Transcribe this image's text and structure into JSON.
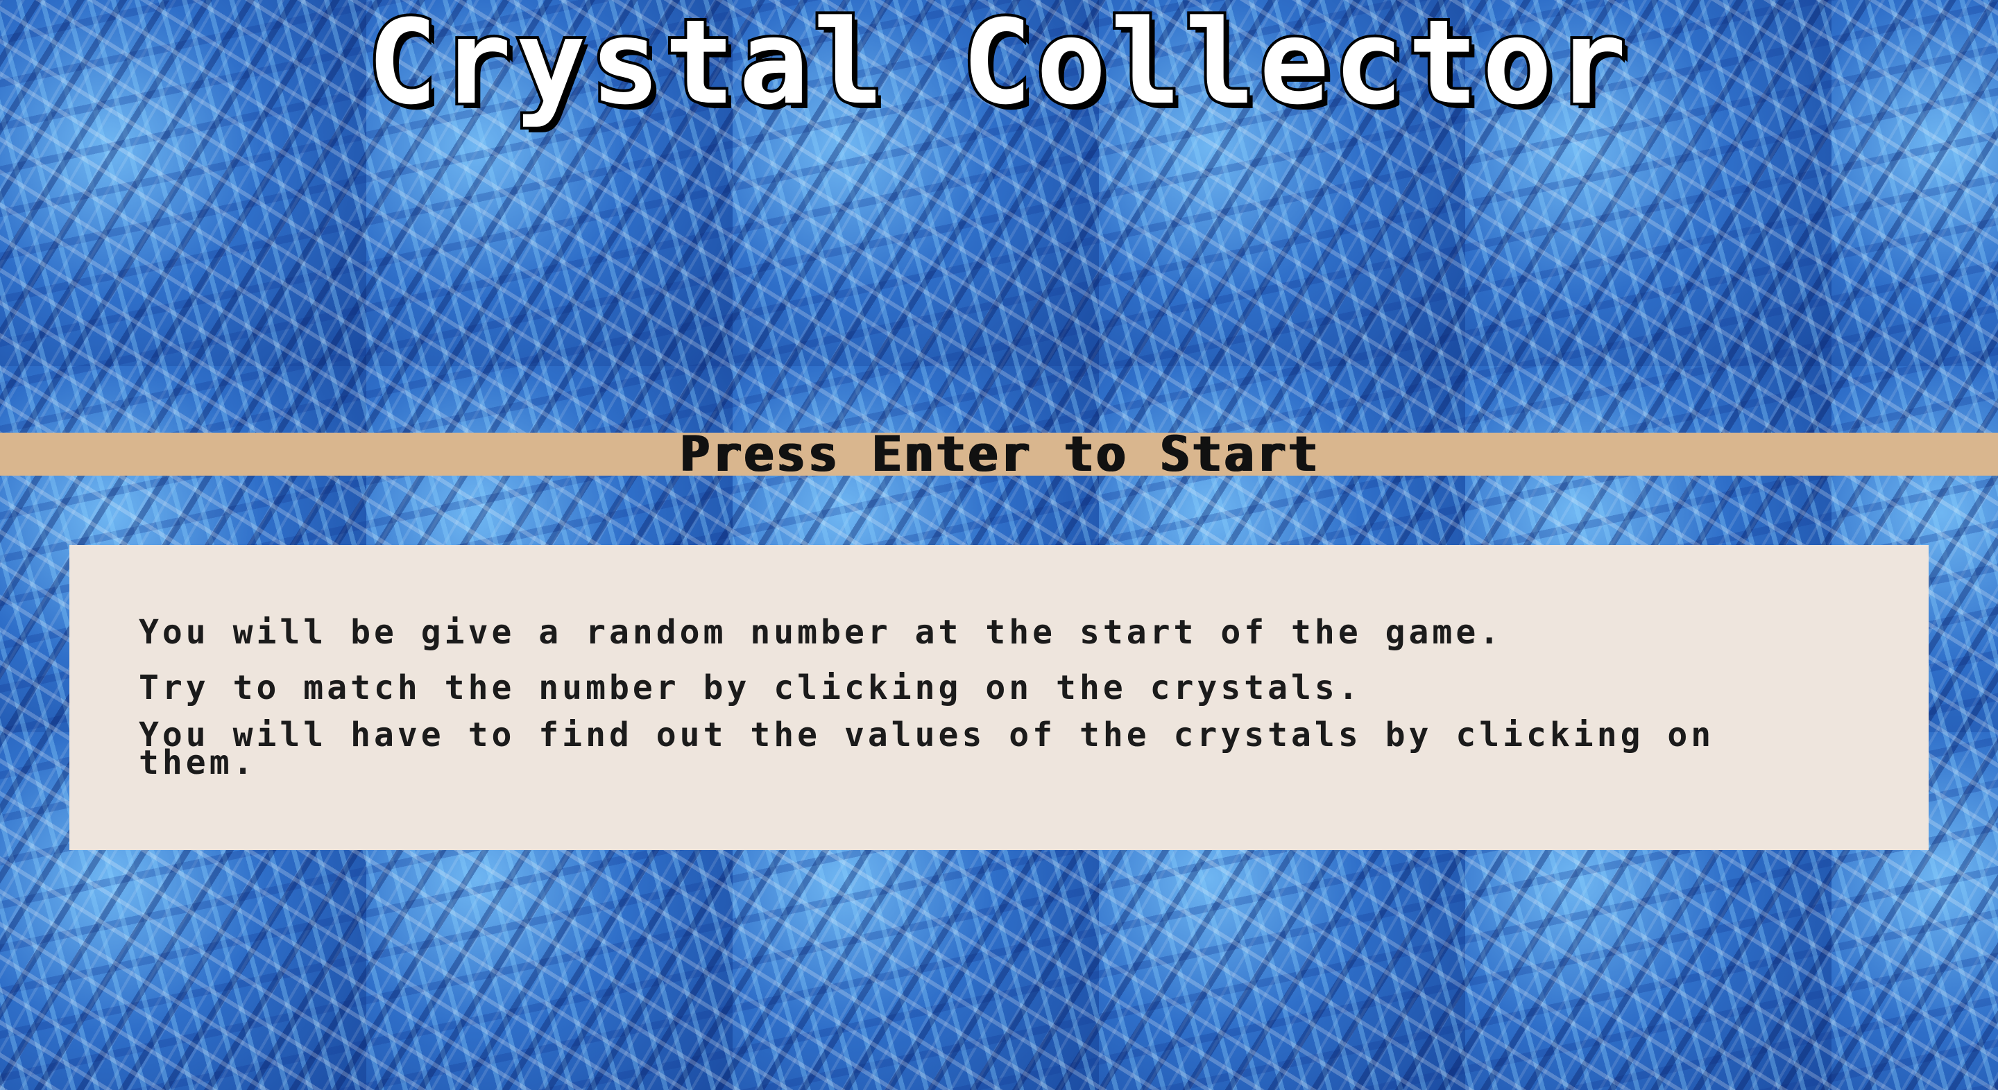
{
  "game": {
    "title": "Crystal Collector",
    "start_prompt": "Press Enter to Start",
    "instructions": [
      "You will be give a random number at the start of the game.",
      "Try to match the number by clicking on the crystals.",
      "You will have to find out the values of the crystals by clicking on them."
    ]
  },
  "colors": {
    "background_crystal_blue": "#2f6fc9",
    "start_bar": "#d9b68e",
    "info_box": "#eee5dd",
    "title_fill": "#ffffff",
    "title_outline": "#000000",
    "text": "#1b1b1b"
  }
}
